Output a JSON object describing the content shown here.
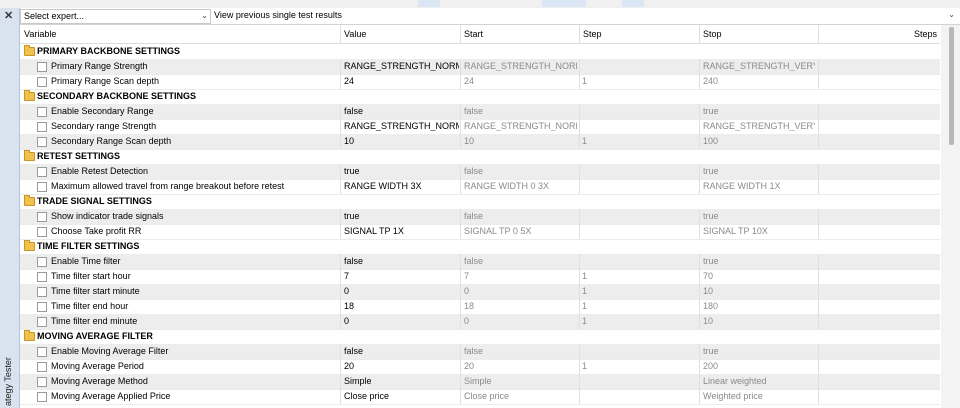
{
  "sidebar": {
    "close_icon": "close-icon",
    "vertical_label": "ategy Tester"
  },
  "toolbar": {
    "expert_select": "Select expert...",
    "results_combo": "View previous single test results"
  },
  "columns": [
    "Variable",
    "Value",
    "Start",
    "Step",
    "Stop",
    "Steps"
  ],
  "rows": [
    {
      "type": "group",
      "label": "PRIMARY BACKBONE SETTINGS"
    },
    {
      "type": "param",
      "name": "Primary Range Strength",
      "value": "RANGE_STRENGTH_NORM...",
      "start": "RANGE_STRENGTH_NORM...",
      "step": "",
      "stop": "RANGE_STRENGTH_VERY_..."
    },
    {
      "type": "param",
      "name": "Primary Range Scan depth",
      "value": "24",
      "start": "24",
      "step": "1",
      "stop": "240"
    },
    {
      "type": "group",
      "label": "SECONDARY BACKBONE SETTINGS"
    },
    {
      "type": "param",
      "name": "Enable Secondary Range",
      "value": "false",
      "start": "false",
      "step": "",
      "stop": "true"
    },
    {
      "type": "param",
      "name": "Secondary range Strength",
      "value": "RANGE_STRENGTH_NORM...",
      "start": "RANGE_STRENGTH_NORM...",
      "step": "",
      "stop": "RANGE_STRENGTH_VERY_..."
    },
    {
      "type": "param",
      "name": "Secondary Range Scan depth",
      "value": "10",
      "start": "10",
      "step": "1",
      "stop": "100"
    },
    {
      "type": "group",
      "label": "RETEST SETTINGS"
    },
    {
      "type": "param",
      "name": "Enable Retest Detection",
      "value": "true",
      "start": "false",
      "step": "",
      "stop": "true"
    },
    {
      "type": "param",
      "name": "Maximum allowed travel from range breakout before retest",
      "value": "RANGE WIDTH 3X",
      "start": "RANGE WIDTH 0 3X",
      "step": "",
      "stop": "RANGE WIDTH 1X"
    },
    {
      "type": "group",
      "label": "TRADE SIGNAL SETTINGS"
    },
    {
      "type": "param",
      "name": "Show indicator trade signals",
      "value": "true",
      "start": "false",
      "step": "",
      "stop": "true"
    },
    {
      "type": "param",
      "name": "Choose Take profit RR",
      "value": "SIGNAL TP 1X",
      "start": "SIGNAL TP 0 5X",
      "step": "",
      "stop": "SIGNAL TP 10X"
    },
    {
      "type": "group",
      "label": "TIME FILTER SETTINGS"
    },
    {
      "type": "param",
      "name": "Enable Time filter",
      "value": "false",
      "start": "false",
      "step": "",
      "stop": "true"
    },
    {
      "type": "param",
      "name": "Time filter start hour",
      "value": "7",
      "start": "7",
      "step": "1",
      "stop": "70"
    },
    {
      "type": "param",
      "name": "Time filter start minute",
      "value": "0",
      "start": "0",
      "step": "1",
      "stop": "10"
    },
    {
      "type": "param",
      "name": "Time filter end hour",
      "value": "18",
      "start": "18",
      "step": "1",
      "stop": "180"
    },
    {
      "type": "param",
      "name": "Time filter end minute",
      "value": "0",
      "start": "0",
      "step": "1",
      "stop": "10"
    },
    {
      "type": "group",
      "label": "MOVING AVERAGE FILTER"
    },
    {
      "type": "param",
      "name": "Enable Moving Average Filter",
      "value": "false",
      "start": "false",
      "step": "",
      "stop": "true"
    },
    {
      "type": "param",
      "name": "Moving Average Period",
      "value": "20",
      "start": "20",
      "step": "1",
      "stop": "200"
    },
    {
      "type": "param",
      "name": "Moving Average Method",
      "value": "Simple",
      "start": "Simple",
      "step": "",
      "stop": "Linear weighted"
    },
    {
      "type": "param",
      "name": "Moving Average Applied Price",
      "value": "Close price",
      "start": "Close price",
      "step": "",
      "stop": "Weighted price"
    }
  ]
}
